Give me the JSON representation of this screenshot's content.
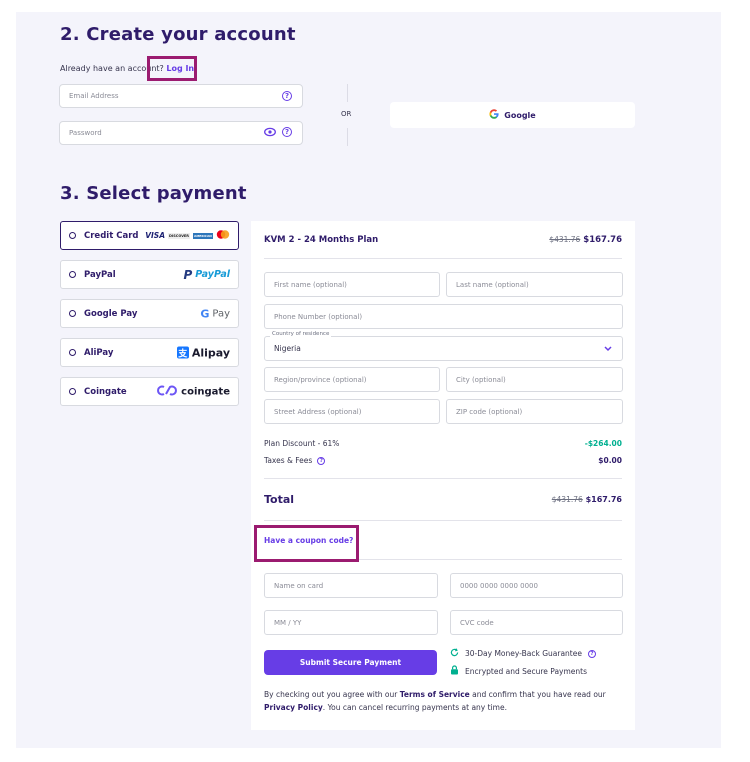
{
  "account": {
    "title": "2. Create your account",
    "already_text": "Already have an account",
    "login_q": "?",
    "login_label": "Log In",
    "email_placeholder": "Email Address",
    "password_placeholder": "Password",
    "or_label": "OR",
    "google_label": "Google"
  },
  "payment": {
    "title": "3. Select payment",
    "methods": [
      {
        "label": "Credit Card",
        "logos": [
          "VISA",
          "DISCOVER",
          "AMERICAN EXPRESS"
        ]
      },
      {
        "label": "PayPal",
        "logo": "PayPal"
      },
      {
        "label": "Google Pay",
        "logo": "Pay"
      },
      {
        "label": "AliPay",
        "logo": "Alipay"
      },
      {
        "label": "Coingate",
        "logo": "coingate"
      }
    ]
  },
  "order": {
    "plan_name": "KVM 2 - 24 Months Plan",
    "old_price": "$431.76",
    "price": "$167.76",
    "first_name": "First name (optional)",
    "last_name": "Last name (optional)",
    "phone": "Phone Number (optional)",
    "country_label": "Country of residence",
    "country_value": "Nigeria",
    "region": "Region/province (optional)",
    "city": "City (optional)",
    "street": "Street Address (optional)",
    "zip": "ZIP code (optional)",
    "discount_label": "Plan Discount - 61%",
    "discount_value": "-$264.00",
    "taxes_label": "Taxes & Fees",
    "taxes_value": "$0.00",
    "total_label": "Total",
    "total_old": "$431.76",
    "total_price": "$167.76",
    "coupon_label": "Have a coupon code?",
    "name_on_card": "Name on card",
    "card_number": "0000 0000 0000 0000",
    "expiry": "MM / YY",
    "cvc": "CVC code",
    "submit_label": "Submit Secure Payment",
    "guarantee": "30-Day Money-Back Guarantee",
    "secure": "Encrypted and Secure Payments",
    "terms_1": "By checking out you agree with our",
    "terms_link": "Terms of Service",
    "terms_2": "and confirm that you have read our",
    "privacy_link": "Privacy Policy",
    "terms_3": ". You can cancel recurring payments at any time."
  },
  "colors": {
    "brand": "#673de6",
    "heading": "#2f1c6a",
    "discount": "#00b090",
    "highlight": "#9b1b70"
  }
}
